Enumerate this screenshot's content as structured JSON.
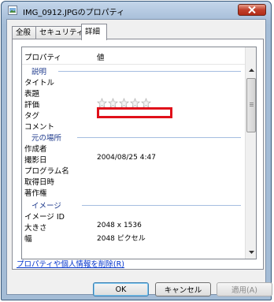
{
  "window": {
    "title": "IMG_0912.JPGのプロパティ",
    "close_glyph": "✕"
  },
  "tabs": [
    {
      "label": "全般"
    },
    {
      "label": "セキュリティ"
    },
    {
      "label": "詳細",
      "active": true
    }
  ],
  "list": {
    "header": {
      "property": "プロパティ",
      "value": "値"
    },
    "sections": {
      "description": "説明",
      "origin": "元の場所",
      "image": "イメージ"
    },
    "rows": {
      "title": {
        "key": "タイトル",
        "value": ""
      },
      "subject": {
        "key": "表題",
        "value": ""
      },
      "rating": {
        "key": "評価",
        "stars": 0
      },
      "tags": {
        "key": "タグ",
        "value": ""
      },
      "comments": {
        "key": "コメント",
        "value": ""
      },
      "author": {
        "key": "作成者",
        "value": ""
      },
      "date_taken": {
        "key": "撮影日",
        "value": "2004/08/25 4:47"
      },
      "program": {
        "key": "プログラム名",
        "value": ""
      },
      "date_acquired": {
        "key": "取得日時",
        "value": ""
      },
      "copyright": {
        "key": "著作権",
        "value": ""
      },
      "image_id": {
        "key": "イメージ ID",
        "value": ""
      },
      "dimensions": {
        "key": "大きさ",
        "value": "2048 x 1536"
      },
      "width": {
        "key": "幅",
        "value": "2048 ピクセル"
      }
    }
  },
  "remove_link": "プロパティや個人情報を削除(R)",
  "buttons": {
    "ok": "OK",
    "cancel": "キャンセル",
    "apply": "適用(A)"
  },
  "colors": {
    "highlight_box": "#e0101a",
    "link": "#0033cc",
    "section_label": "#1e3a8c"
  },
  "icons": {
    "title": "image-file-icon",
    "close": "close-icon",
    "scroll_up": "arrow-up-icon",
    "scroll_down": "arrow-down-icon",
    "rating": "star-icon"
  }
}
